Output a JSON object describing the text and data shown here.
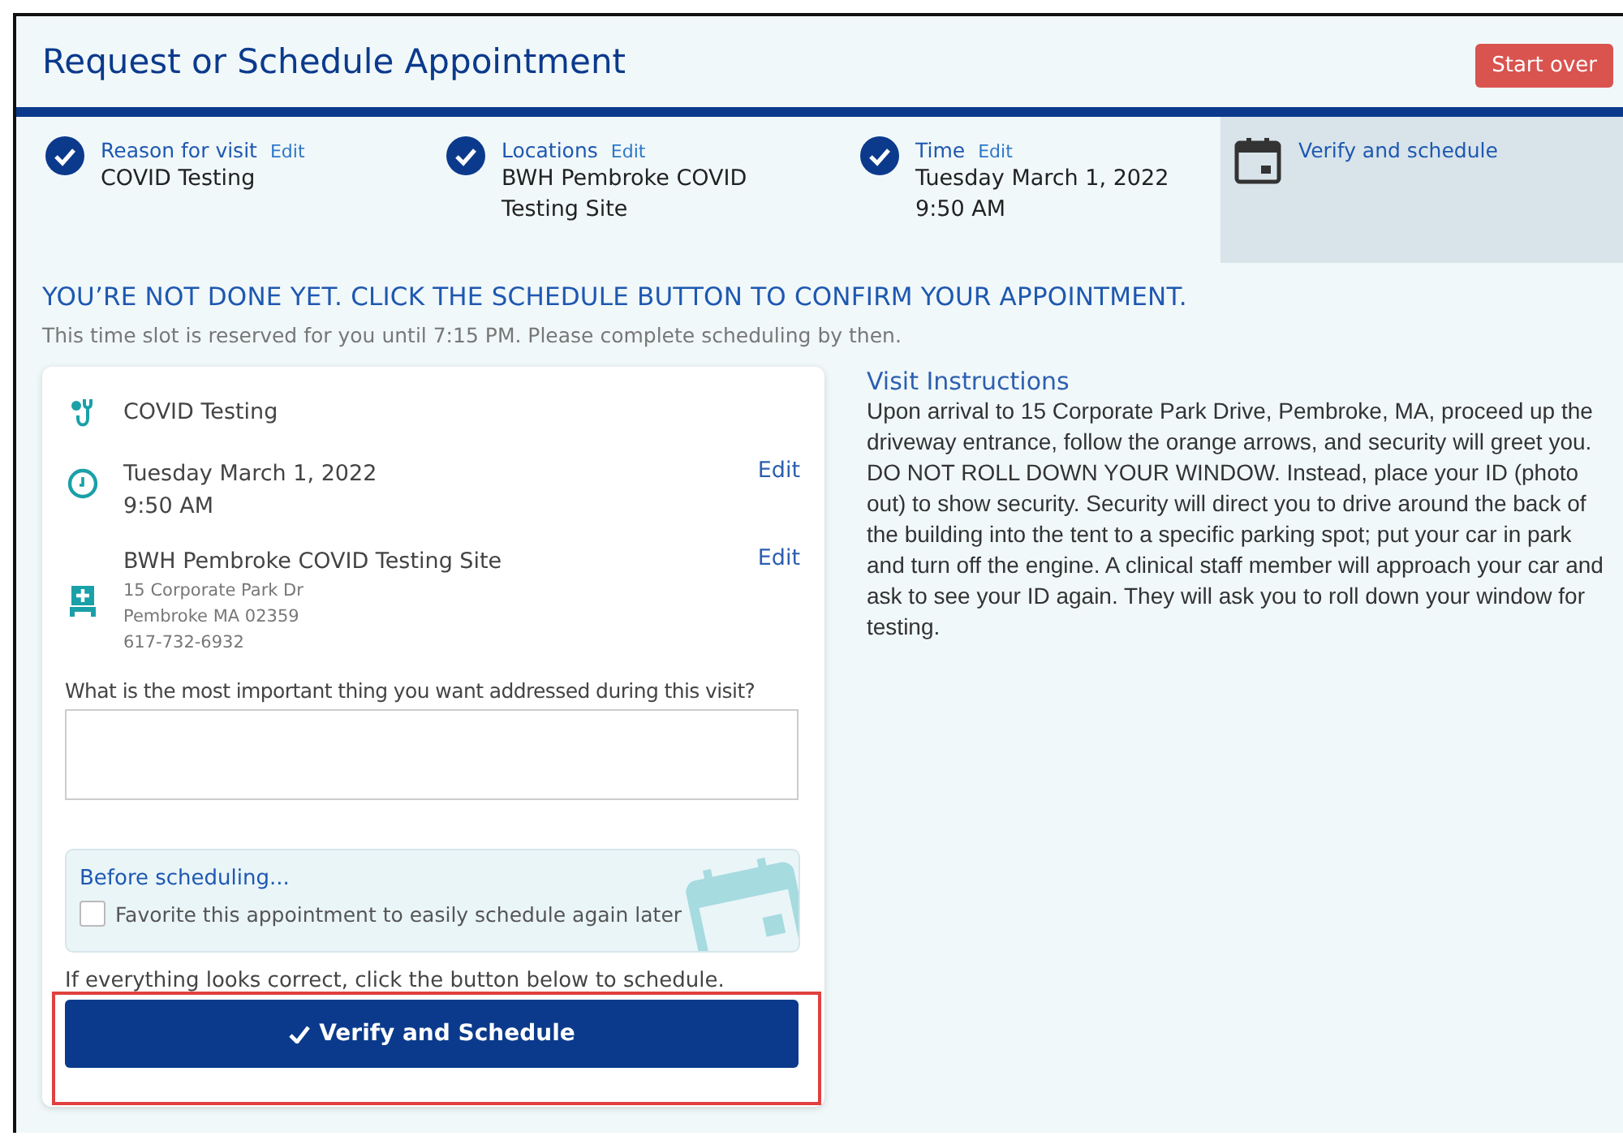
{
  "header": {
    "title": "Request or Schedule Appointment",
    "start_over": "Start over"
  },
  "steps": [
    {
      "label": "Reason for visit",
      "edit": "Edit",
      "value": "COVID Testing",
      "completed": true,
      "selected": false
    },
    {
      "label": "Locations",
      "edit": "Edit",
      "value": "BWH Pembroke COVID Testing Site",
      "completed": true,
      "selected": false
    },
    {
      "label": "Time",
      "edit": "Edit",
      "value": "Tuesday March 1, 2022 9:50 AM",
      "completed": true,
      "selected": false
    },
    {
      "label": "Verify and schedule",
      "completed": false,
      "selected": true
    }
  ],
  "notice": {
    "heading": "YOU’RE NOT DONE YET. CLICK THE SCHEDULE BUTTON TO CONFIRM YOUR APPOINTMENT.",
    "subtext": "This time slot is reserved for you until 7:15 PM. Please complete scheduling by then."
  },
  "summary": [
    {
      "kind": "reason",
      "title": "COVID Testing"
    },
    {
      "kind": "time",
      "title": "Tuesday March 1, 2022",
      "subtitle": "9:50 AM",
      "edit": "Edit"
    },
    {
      "kind": "location",
      "title": "BWH Pembroke COVID Testing Site",
      "details": [
        "15 Corporate Park Dr",
        "Pembroke MA 02359",
        "617-732-6932"
      ],
      "edit": "Edit"
    }
  ],
  "question": {
    "label": "What is the most important thing you want addressed during this visit?"
  },
  "before": {
    "heading": "Before scheduling...",
    "checkbox_label": "Favorite this appointment to easily schedule again later",
    "checked": false
  },
  "confirm_text": "If everything looks correct, click the button below to schedule.",
  "schedule_button": "Verify and Schedule",
  "instructions": {
    "heading": "Visit Instructions",
    "body": "Upon arrival to 15 Corporate Park Drive, Pembroke, MA, proceed up the driveway entrance, follow the orange arrows, and security will greet you. DO NOT ROLL DOWN YOUR WINDOW. Instead, place your ID (photo out) to show security. Security will direct you to drive around the back of the building into the tent to a specific parking spot; put your car in park and turn off the engine. A clinical staff member will approach your car and ask to see your ID again. They will ask you to roll down your window for testing."
  }
}
